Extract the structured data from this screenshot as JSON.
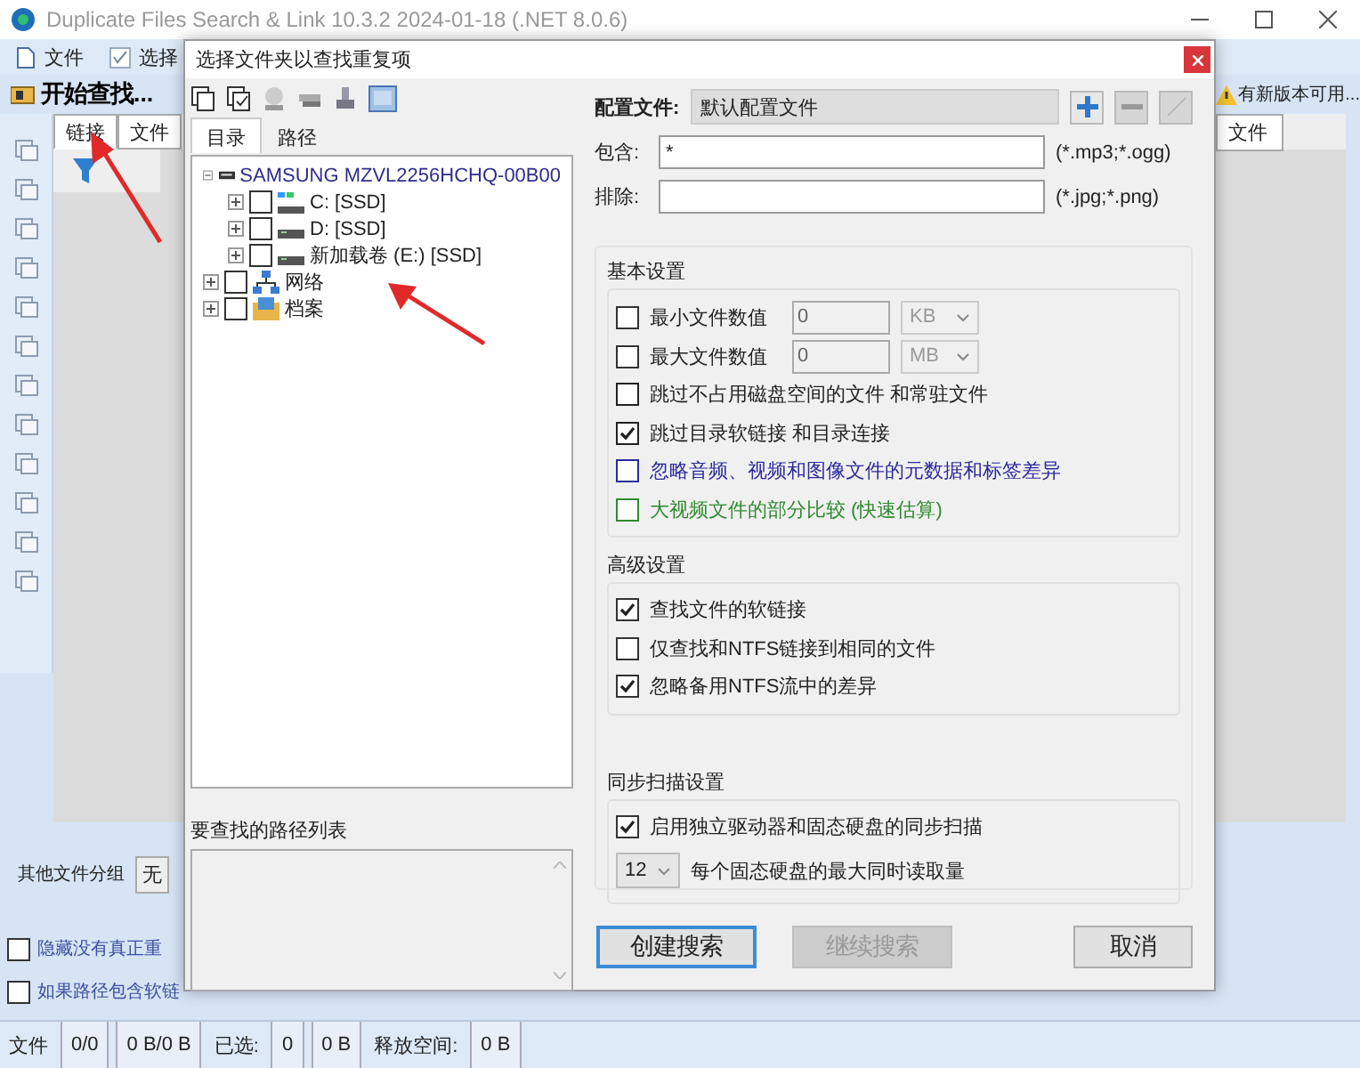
{
  "window": {
    "title": "Duplicate Files Search & Link 10.3.2 2024-01-18 (.NET 8.0.6)"
  },
  "menu": [
    {
      "label": "文件",
      "kind": "file"
    },
    {
      "label": "选择",
      "kind": "select"
    }
  ],
  "toolbar": {
    "start_button": "开始查找...",
    "update_notice": "有新版本可用..."
  },
  "tabs": [
    {
      "label": "链接",
      "selected": true
    }
  ],
  "columns": [
    {
      "label": "文件"
    },
    {
      "label": "文件"
    }
  ],
  "grouping": {
    "label": "其他文件分组",
    "value": "无"
  },
  "options": [
    {
      "label": "隐藏没有真正重",
      "checked": false
    },
    {
      "label": "如果路径包含软链",
      "checked": false
    }
  ],
  "status_bar": {
    "files_label": "文件",
    "files": "0/0",
    "size": "0 B/0 B",
    "selected_label": "已选:",
    "selected_count": "0",
    "selected_size": "0 B",
    "freed_label": "释放空间:",
    "freed": "0 B"
  },
  "dialog": {
    "title": "选择文件夹以查找重复项",
    "tabs": [
      {
        "label": "目录",
        "selected": true
      },
      {
        "label": "路径",
        "selected": false
      }
    ],
    "tree": [
      {
        "label": "SAMSUNG MZVL2256HCHQ-00B00",
        "kind": "disk",
        "expanded": true,
        "children": [
          {
            "label": "C: [SSD]",
            "kind": "system-drive",
            "expanded": false,
            "checked": false
          },
          {
            "label": "D: [SSD]",
            "kind": "drive",
            "expanded": false,
            "checked": false
          },
          {
            "label": "新加载卷 (E:) [SSD]",
            "kind": "drive",
            "expanded": false,
            "checked": false
          }
        ]
      },
      {
        "label": "网络",
        "kind": "network",
        "expanded": false,
        "checked": false
      },
      {
        "label": "档案",
        "kind": "archive",
        "expanded": false,
        "checked": false
      }
    ],
    "path_list": {
      "label": "要查找的路径列表"
    },
    "profile": {
      "label": "配置文件:",
      "value": "默认配置文件",
      "buttons": [
        {
          "kind": "add",
          "disabled": false
        },
        {
          "kind": "remove",
          "disabled": true
        },
        {
          "kind": "edit",
          "disabled": true
        }
      ]
    },
    "include": {
      "label": "包含:",
      "value": "*",
      "hint": "(*.mp3;*.ogg)"
    },
    "exclude": {
      "label": "排除:",
      "hint": "(*.jpg;*.png)"
    },
    "basic": {
      "title": "基本设置",
      "sizes": [
        {
          "label": "最小文件数值",
          "checked": false,
          "value": "0",
          "unit": "KB"
        },
        {
          "label": "最大文件数值",
          "checked": false,
          "value": "0",
          "unit": "MB"
        }
      ],
      "options": [
        {
          "label": "跳过不占用磁盘空间的文件 和常驻文件",
          "checked": false,
          "color": "#222222"
        },
        {
          "label": "跳过目录软链接 和目录连接",
          "checked": true,
          "color": "#222222"
        },
        {
          "label": "忽略音频、视频和图像文件的元数据和标签差异",
          "checked": false,
          "color": "#2b2b9e"
        },
        {
          "label": "大视频文件的部分比较 (快速估算)",
          "checked": false,
          "color": "#2f8a2f"
        }
      ]
    },
    "advanced": {
      "title": "高级设置",
      "options": [
        {
          "label": "查找文件的软链接",
          "checked": true
        },
        {
          "label": "仅查找和NTFS链接到相同的文件",
          "checked": false
        },
        {
          "label": "忽略备用NTFS流中的差异",
          "checked": true
        }
      ]
    },
    "sync": {
      "title": "同步扫描设置",
      "options": [
        {
          "label": "启用独立驱动器和固态硬盘的同步扫描",
          "checked": true
        }
      ],
      "threads": {
        "value": "12",
        "label": "每个固态硬盘的最大同时读取量"
      }
    },
    "buttons": [
      {
        "label": "创建搜索",
        "disabled": false,
        "default": true
      },
      {
        "label": "继续搜索",
        "disabled": true,
        "default": false
      },
      {
        "label": "取消",
        "disabled": false,
        "default": false
      }
    ]
  }
}
